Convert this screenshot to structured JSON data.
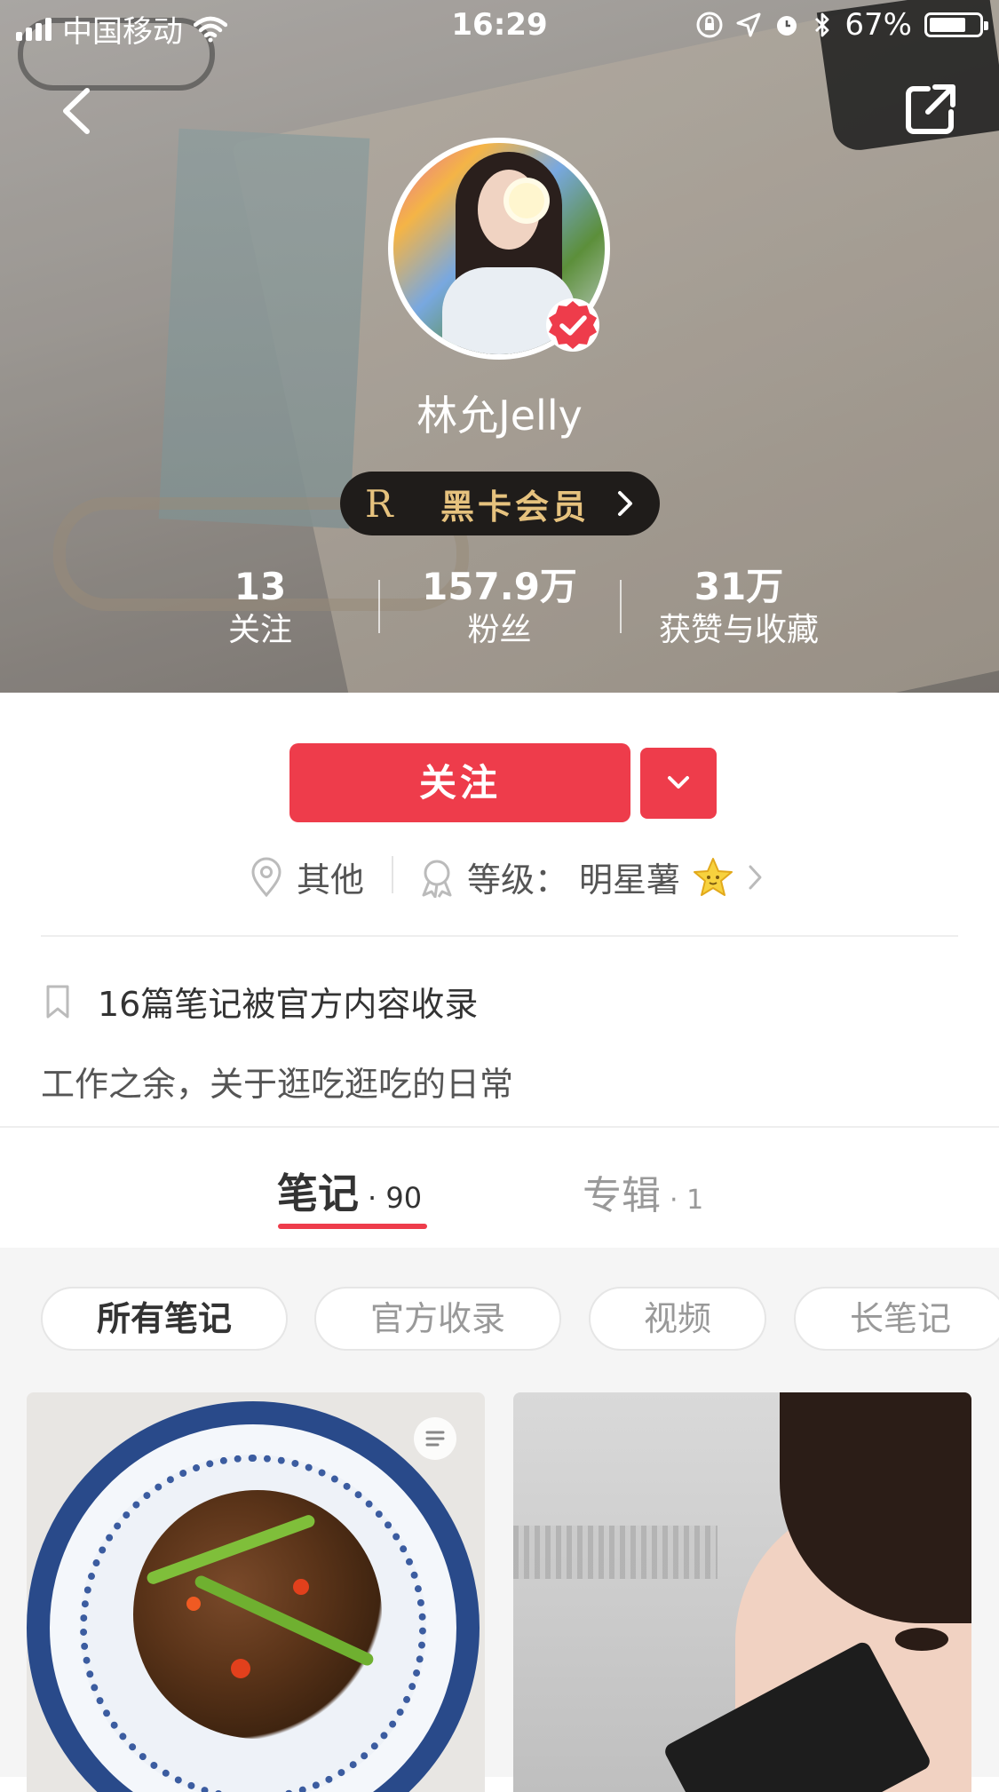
{
  "status_bar": {
    "carrier": "中国移动",
    "time": "16:29",
    "battery": "67%",
    "battery_level": 0.67,
    "icons": [
      "signal-icon",
      "wifi-icon",
      "rotation-lock-icon",
      "location-icon",
      "alarm-icon",
      "bluetooth-icon",
      "battery-icon"
    ]
  },
  "nav": {
    "back_icon": "chevron-left-icon",
    "share_icon": "share-external-icon"
  },
  "profile": {
    "name": "林允Jelly",
    "verified_icon": "verified-check-icon",
    "vip_logo": "R",
    "vip_label": "黑卡会员",
    "stats": [
      {
        "value": "13",
        "label": "关注"
      },
      {
        "value": "157.9万",
        "label": "粉丝"
      },
      {
        "value": "31万",
        "label": "获赞与收藏"
      }
    ]
  },
  "actions": {
    "follow_label": "关注",
    "more_icon": "chevron-down-icon"
  },
  "meta": {
    "location": "其他",
    "level_label": "等级：",
    "level_value": "明星薯",
    "level_icon": "star-icon"
  },
  "collected_text": "16篇笔记被官方内容收录",
  "bio": "工作之余，关于逛吃逛吃的日常",
  "tabs": [
    {
      "label": "笔记",
      "count": "· 90",
      "active": true
    },
    {
      "label": "专辑",
      "count": "· 1",
      "active": false
    }
  ],
  "filters": [
    "所有笔记",
    "官方收录",
    "视频",
    "长笔记"
  ],
  "colors": {
    "accent": "#ee3c4b",
    "vip_gold": "#e6c27e",
    "vip_bg": "#1f1c1a"
  }
}
